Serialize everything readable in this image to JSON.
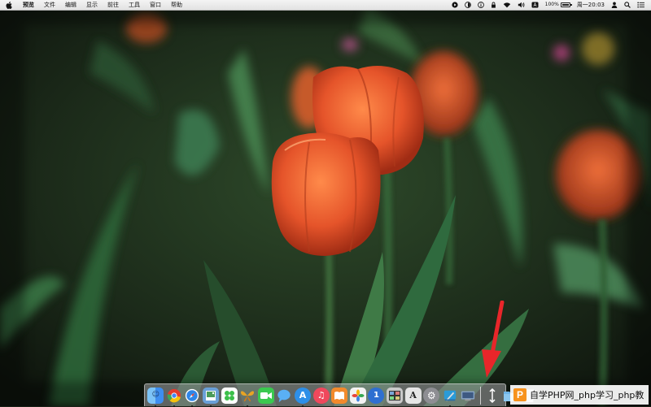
{
  "menubar": {
    "app_name": "预览",
    "menus": [
      "文件",
      "编辑",
      "显示",
      "前往",
      "工具",
      "窗口",
      "帮助"
    ],
    "status": {
      "battery_percent": "100%",
      "battery_level": 1.0,
      "clock": "周一20:03"
    },
    "icons": [
      "play-circle-icon",
      "moon-icon",
      "info-icon",
      "lock-icon",
      "wifi-icon",
      "volume-icon",
      "input-method-icon",
      "user-icon",
      "search-icon",
      "list-icon"
    ]
  },
  "dock": {
    "apps": [
      {
        "name": "finder",
        "icon": "finder-icon",
        "color": "#3d8ef0",
        "running": true
      },
      {
        "name": "chrome",
        "icon": "chrome-icon",
        "color": "#e33b2e",
        "running": true
      },
      {
        "name": "safari",
        "icon": "safari-icon",
        "color": "#2f86e8",
        "running": true
      },
      {
        "name": "preview",
        "icon": "preview-icon",
        "color": "#6aa0d8",
        "running": true
      },
      {
        "name": "clover",
        "icon": "clover-icon",
        "color": "#3bbf4a",
        "running": false
      },
      {
        "name": "butterfly",
        "icon": "butterfly-icon",
        "color": "#e8a424",
        "running": true
      },
      {
        "name": "facetime",
        "icon": "facetime-icon",
        "color": "#3ac94f",
        "running": false
      },
      {
        "name": "messages",
        "icon": "messages-icon",
        "color": "#5ab0f5",
        "running": false
      },
      {
        "name": "app-store",
        "icon": "app-store-icon",
        "color": "#2d8fe8",
        "running": true
      },
      {
        "name": "music",
        "icon": "music-icon",
        "color": "#f0485c",
        "running": false
      },
      {
        "name": "books",
        "icon": "books-icon",
        "color": "#f28a2c",
        "running": false
      },
      {
        "name": "photos",
        "icon": "photos-icon",
        "color": "#f3f3f3",
        "running": false
      },
      {
        "name": "1password",
        "icon": "onepassword-icon",
        "color": "#2e6fd1",
        "running": false
      },
      {
        "name": "photo-booth",
        "icon": "photo-booth-icon",
        "color": "#c9c9c9",
        "running": false
      },
      {
        "name": "font-book",
        "icon": "font-book-icon",
        "color": "#d9d9d9",
        "running": false
      },
      {
        "name": "system-preferences",
        "icon": "system-preferences-icon",
        "color": "#8e8e93",
        "running": false
      },
      {
        "name": "xcode",
        "icon": "xcode-icon",
        "color": "#2a9bd8",
        "running": true
      },
      {
        "name": "screen-sharing",
        "icon": "screen-sharing-icon",
        "color": "#8aa7c8",
        "running": false
      }
    ],
    "right": [
      {
        "name": "downloads-stack",
        "icon": "downloads-stack-icon"
      },
      {
        "name": "folder",
        "icon": "folder-icon",
        "color": "#6fb4e8"
      },
      {
        "name": "trash",
        "icon": "trash-icon",
        "color": "#c8ccd0"
      }
    ]
  },
  "annotation": {
    "icon": "red-arrow-icon",
    "color": "#e8262a"
  },
  "watermark": {
    "logo": "P",
    "text": "自学PHP网_php学习_php教"
  }
}
